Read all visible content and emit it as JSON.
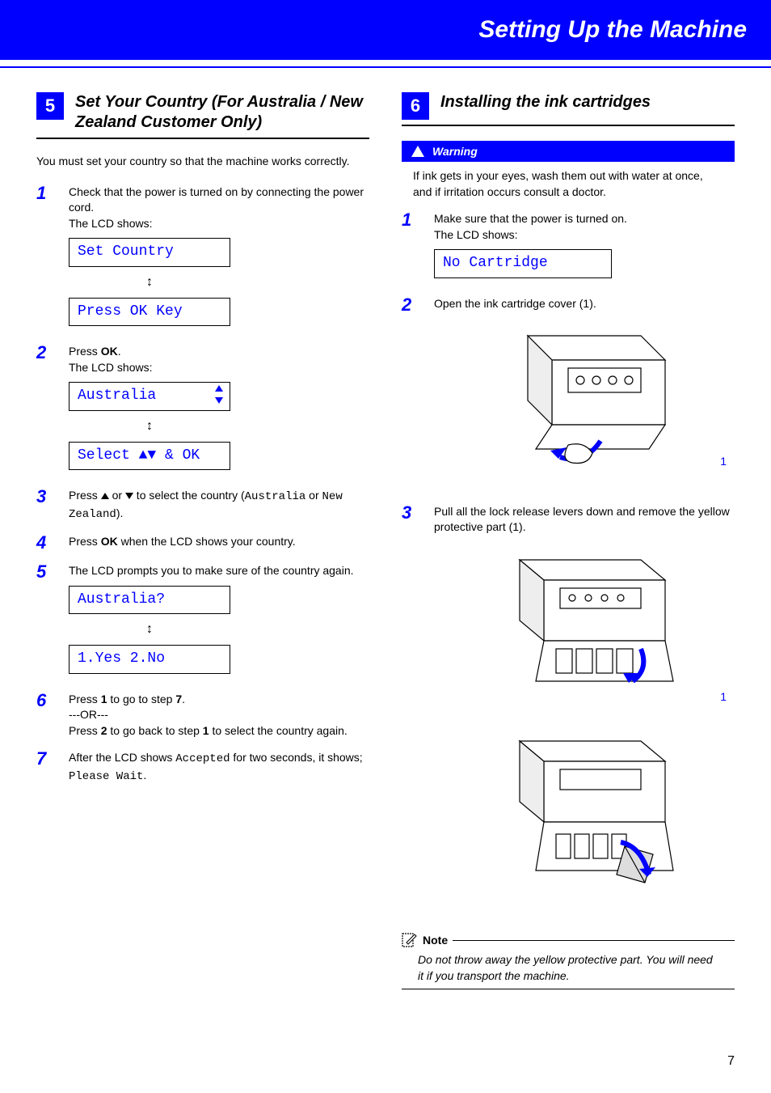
{
  "header": {
    "title": "Setting Up the Machine"
  },
  "left": {
    "section_num": "5",
    "section_title": "Set Your Country (For Australia / New Zealand Customer Only)",
    "intro": "You must set your country so that the machine works correctly.",
    "steps": {
      "s1": {
        "num": "1",
        "a": "Check that the power is turned on by connecting the power cord.",
        "b": "The LCD shows:",
        "lcd1": "Set Country",
        "lcd2": "Press OK Key"
      },
      "s2": {
        "num": "2",
        "a": "Press ",
        "ok": "OK",
        "b": ".",
        "c": "The LCD shows:",
        "lcd1": "Australia",
        "lcd2": "Select ▲▼ & OK"
      },
      "s3": {
        "num": "3",
        "a": "Press ",
        "b": " or ",
        "c": " to select the country (",
        "opt1": "Australia",
        "or": " or ",
        "opt2": "New Zealand",
        "d": ")."
      },
      "s4": {
        "num": "4",
        "a": "Press ",
        "ok": "OK",
        "b": " when the LCD shows your country."
      },
      "s5": {
        "num": "5",
        "a": "The LCD prompts you to make sure of the country again.",
        "lcd1": "Australia?",
        "lcd2": "1.Yes 2.No"
      },
      "s6": {
        "num": "6",
        "a": "Press ",
        "k1": "1",
        "b": " to go to step ",
        "ref1": "7",
        "c": ".",
        "or": "---OR---",
        "d": "Press ",
        "k2": "2",
        "e": " to go back to step ",
        "ref2": "1",
        "f": " to select the country again."
      },
      "s7": {
        "num": "7",
        "a": "After the LCD shows ",
        "accepted": "Accepted",
        "b": " for two seconds, it shows; ",
        "wait": "Please Wait",
        "c": "."
      }
    }
  },
  "right": {
    "section_num": "6",
    "section_title": "Installing the ink cartridges",
    "warning_label": "Warning",
    "warning_body": "If ink gets in your eyes, wash them out with water at once, and if irritation occurs consult a doctor.",
    "steps": {
      "s1": {
        "num": "1",
        "a": "Make sure that the power is turned on.",
        "b": "The LCD shows:",
        "lcd1": "No Cartridge"
      },
      "s2": {
        "num": "2",
        "a": "Open the ink cartridge cover (1).",
        "callout": "1"
      },
      "s3": {
        "num": "3",
        "a": "Pull all the lock release levers down and remove the yellow protective part (1).",
        "callout": "1"
      }
    },
    "note_label": "Note",
    "note_body": "Do not throw away the yellow protective part. You will need it if you transport the machine."
  },
  "page_number": "7"
}
